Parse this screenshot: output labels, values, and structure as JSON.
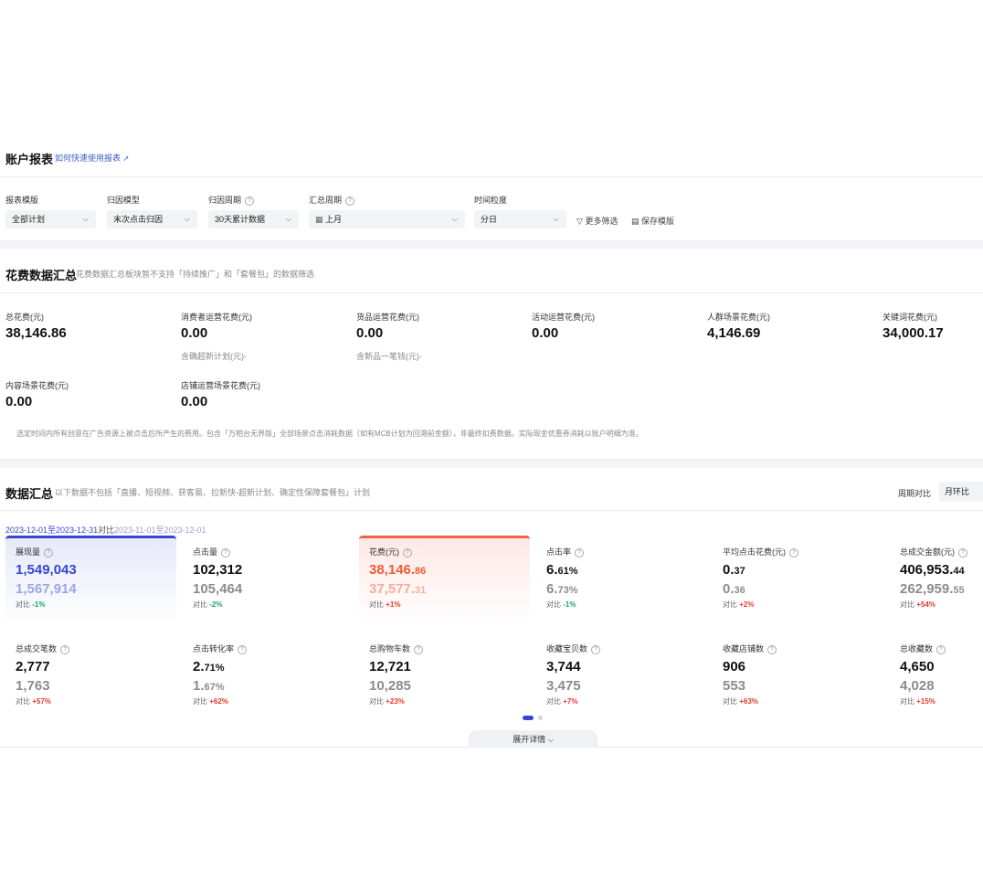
{
  "header": {
    "title": "账户报表",
    "help_link": "如何快速使用报表"
  },
  "filters": [
    {
      "label": "报表模版",
      "value": "全部计划",
      "help": false
    },
    {
      "label": "归因模型",
      "value": "末次点击归因",
      "help": false
    },
    {
      "label": "归因周期",
      "value": "30天累计数据",
      "help": true
    },
    {
      "label": "汇总周期",
      "value": "上月",
      "help": true
    },
    {
      "label": "时间粒度",
      "value": "分日",
      "help": false
    }
  ],
  "toolbar": {
    "more_filter": "更多筛选",
    "save_template": "保存模版"
  },
  "spend": {
    "title": "花费数据汇总",
    "subtitle": "花费数据汇总板块暂不支持「持续推广」和「套餐包」的数据筛选",
    "metrics": [
      {
        "label": "总花费(元)",
        "value": "38,146.86",
        "sub": ""
      },
      {
        "label": "消费者运营花费(元)",
        "value": "0.00",
        "sub": "含确超新计划(元)-"
      },
      {
        "label": "货品运营花费(元)",
        "value": "0.00",
        "sub": "含新品一笔钱(元)-"
      },
      {
        "label": "活动运营花费(元)",
        "value": "0.00",
        "sub": ""
      },
      {
        "label": "人群场景花费(元)",
        "value": "4,146.69",
        "sub": ""
      },
      {
        "label": "关键词花费(元)",
        "value": "34,000.17",
        "sub": ""
      },
      {
        "label": "内容场景花费(元)",
        "value": "0.00",
        "sub": ""
      },
      {
        "label": "店铺运营场景花费(元)",
        "value": "0.00",
        "sub": ""
      }
    ],
    "note": "选定时间内所有创意在广告资源上被点击后所产生的费用。包含「万相台无界版」全部场景点击消耗数据（如有MCB计划为回溯前金额），非最终扣费数据。实际现金优惠券消耗以账户明细为准。"
  },
  "summary": {
    "title": "数据汇总",
    "subtitle": "以下数据不包括「直播、短视频、获客易、拉新快-超新计划、确定性保障套餐包」计划",
    "compare_label": "周期对比",
    "compare_value": "月环比",
    "range_current": "2023-12-01至2023-12-31",
    "range_vs": "对比",
    "range_prev": "2023-11-01至2023-12-01",
    "cmp_label": "对比",
    "expand": "展开详情",
    "cards": [
      {
        "label": "展现量",
        "v1": "1,549,043",
        "v1d": "",
        "v2": "1,567,914",
        "v2d": "",
        "cmp": "-1%",
        "dir": "down",
        "style": "blue"
      },
      {
        "label": "点击量",
        "v1": "102,312",
        "v1d": "",
        "v2": "105,464",
        "v2d": "",
        "cmp": "-2%",
        "dir": "down",
        "style": ""
      },
      {
        "label": "花费(元)",
        "v1": "38,146.",
        "v1d": "86",
        "v2": "37,577.",
        "v2d": "31",
        "cmp": "+1%",
        "dir": "up",
        "style": "red"
      },
      {
        "label": "点击率",
        "v1": "6.",
        "v1d": "61%",
        "v2": "6.",
        "v2d": "73%",
        "cmp": "-1%",
        "dir": "down",
        "style": ""
      },
      {
        "label": "平均点击花费(元)",
        "v1": "0.",
        "v1d": "37",
        "v2": "0.",
        "v2d": "36",
        "cmp": "+2%",
        "dir": "up",
        "style": ""
      },
      {
        "label": "总成交金额(元)",
        "v1": "406,953.",
        "v1d": "44",
        "v2": "262,959.",
        "v2d": "55",
        "cmp": "+54%",
        "dir": "up",
        "style": ""
      },
      {
        "label": "总成交笔数",
        "v1": "2,777",
        "v1d": "",
        "v2": "1,763",
        "v2d": "",
        "cmp": "+57%",
        "dir": "up",
        "style": ""
      },
      {
        "label": "点击转化率",
        "v1": "2.",
        "v1d": "71%",
        "v2": "1.",
        "v2d": "67%",
        "cmp": "+62%",
        "dir": "up",
        "style": ""
      },
      {
        "label": "总购物车数",
        "v1": "12,721",
        "v1d": "",
        "v2": "10,285",
        "v2d": "",
        "cmp": "+23%",
        "dir": "up",
        "style": ""
      },
      {
        "label": "收藏宝贝数",
        "v1": "3,744",
        "v1d": "",
        "v2": "3,475",
        "v2d": "",
        "cmp": "+7%",
        "dir": "up",
        "style": ""
      },
      {
        "label": "收藏店铺数",
        "v1": "906",
        "v1d": "",
        "v2": "553",
        "v2d": "",
        "cmp": "+63%",
        "dir": "up",
        "style": ""
      },
      {
        "label": "总收藏数",
        "v1": "4,650",
        "v1d": "",
        "v2": "4,028",
        "v2d": "",
        "cmp": "+15%",
        "dir": "up",
        "style": ""
      }
    ]
  },
  "colors": {
    "accent": "#3a45d3",
    "spend": "#f26344",
    "up": "#e23a2f",
    "down": "#1aa35c",
    "link": "#3a5ccc"
  }
}
